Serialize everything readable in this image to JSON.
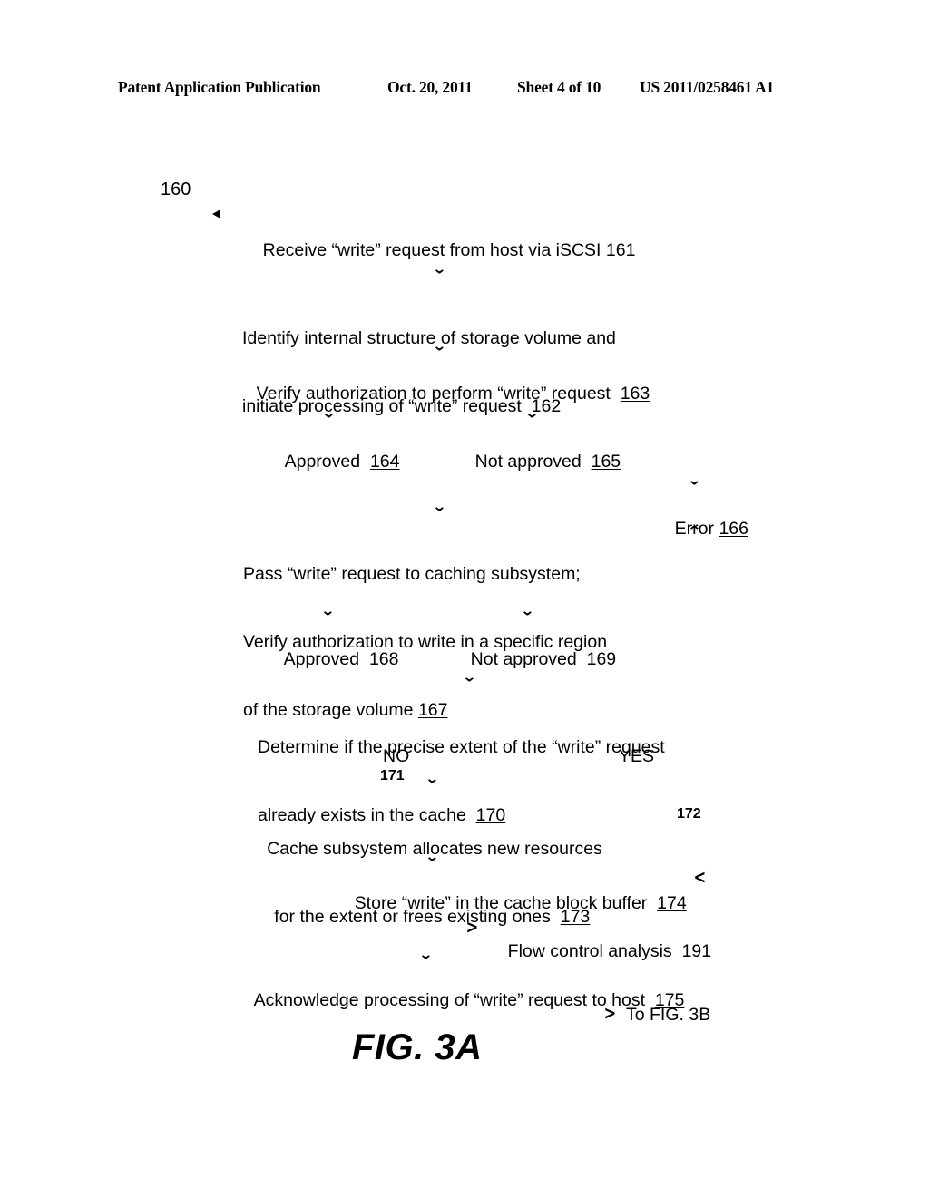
{
  "header": {
    "publication": "Patent Application Publication",
    "date": "Oct. 20, 2011",
    "sheet": "Sheet 4 of 10",
    "patent_number": "US 2011/0258461 A1"
  },
  "figure": {
    "caption": "FIG. 3A",
    "diagram_number": "160"
  },
  "glyphs": {
    "down": "⌄",
    "up": "⌃",
    "left": "<",
    "right": ">"
  },
  "steps": {
    "s161": {
      "line1": "Receive “write” request from host via iSCSI",
      "ref": "161"
    },
    "s162": {
      "line1": "Identify internal structure of storage volume and",
      "line2": "initiate processing of “write” request",
      "ref": "162"
    },
    "s163": {
      "line1": "Verify authorization to perform “write” request",
      "ref": "163"
    },
    "s164": {
      "line1": "Approved",
      "ref": "164"
    },
    "s165": {
      "line1": "Not approved",
      "ref": "165"
    },
    "s166": {
      "line1": "Error",
      "ref": "166"
    },
    "s167": {
      "line1": "Pass “write” request to caching subsystem;",
      "line2": "Verify authorization to write in a specific region",
      "line3": "of the storage volume",
      "ref": "167"
    },
    "s168": {
      "line1": "Approved",
      "ref": "168"
    },
    "s169": {
      "line1": "Not approved",
      "ref": "169"
    },
    "s170": {
      "line1": "Determine if the precise extent of the “write” request",
      "line2": "already exists in the cache",
      "ref": "170"
    },
    "s173": {
      "line1": "Cache subsystem allocates new resources",
      "line2": "for the extent or frees existing ones",
      "ref": "173"
    },
    "s174": {
      "line1": "Store “write” in the cache block buffer",
      "ref": "174"
    },
    "s191": {
      "line1": "Flow control analysis",
      "ref": "191"
    },
    "s175": {
      "line1": "Acknowledge processing of “write” request to host",
      "ref": "175"
    },
    "s_tofig": {
      "line1": "To FIG. 3B"
    }
  },
  "branches": {
    "no_label": "NO",
    "no_ref": "171",
    "yes_label": "YES",
    "yes_ref": "172"
  }
}
